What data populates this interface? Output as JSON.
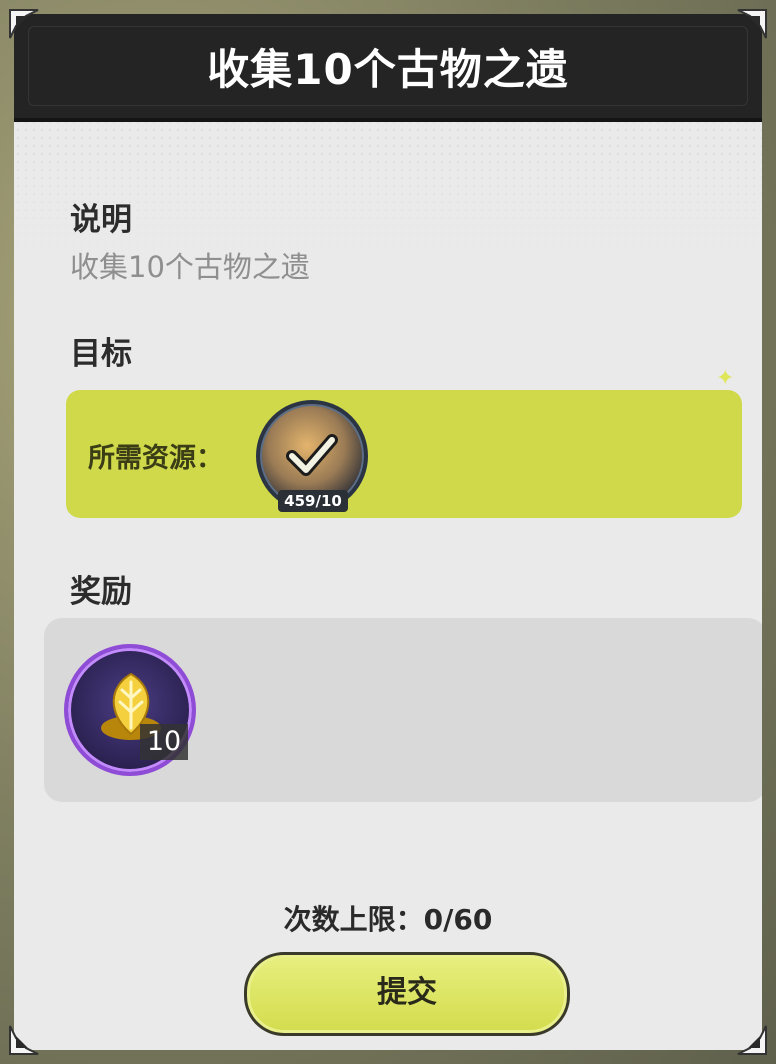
{
  "dialog": {
    "title": "收集10个古物之遗"
  },
  "description": {
    "label": "说明",
    "text": "收集10个古物之遗"
  },
  "goal": {
    "label": "目标",
    "resource_label": "所需资源：",
    "resource_icon": "relic-item-icon",
    "resource_count": "459/10",
    "completed": true
  },
  "reward": {
    "label": "奖励",
    "items": [
      {
        "icon": "golden-leaf-icon",
        "quantity": "10"
      }
    ]
  },
  "limit": {
    "text": "次数上限：0/60"
  },
  "submit": {
    "label": "提交"
  },
  "colors": {
    "header": "#242424",
    "panel": "#eaeaea",
    "accent": "#cfd94a",
    "reward_border": "#8f4cd6"
  }
}
